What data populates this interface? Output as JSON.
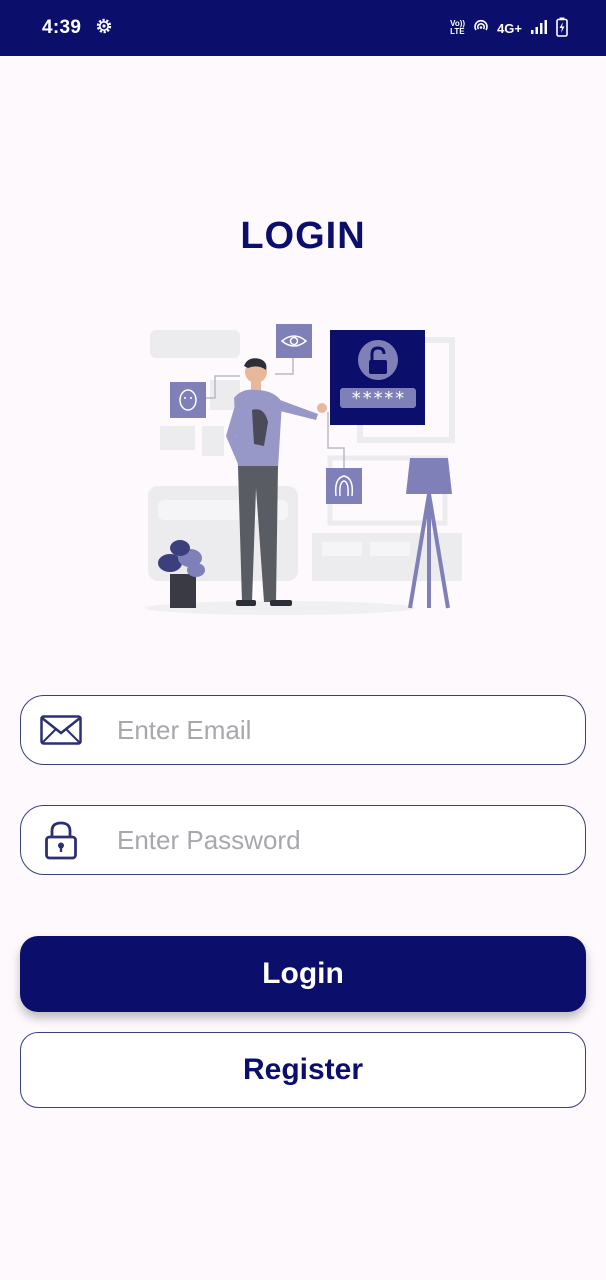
{
  "status_bar": {
    "time": "4:39",
    "volte_top": "Vo))",
    "volte_bottom": "LTE",
    "network": "4G+",
    "icons": [
      "settings-gear-icon",
      "hotspot-icon",
      "signal-icon",
      "battery-charging-icon"
    ]
  },
  "page": {
    "title": "LOGIN"
  },
  "illustration": {
    "icon": "login-security-illustration",
    "password_mask": "*****"
  },
  "form": {
    "email": {
      "placeholder": "Enter Email",
      "value": "",
      "icon": "envelope-icon"
    },
    "password": {
      "placeholder": "Enter Password",
      "value": "",
      "icon": "lock-icon"
    }
  },
  "actions": {
    "login_label": "Login",
    "register_label": "Register"
  },
  "colors": {
    "primary": "#0b0f6b",
    "accent_purple": "#7f80b8",
    "background": "#fdf9fd",
    "placeholder": "#a7a7ad"
  }
}
